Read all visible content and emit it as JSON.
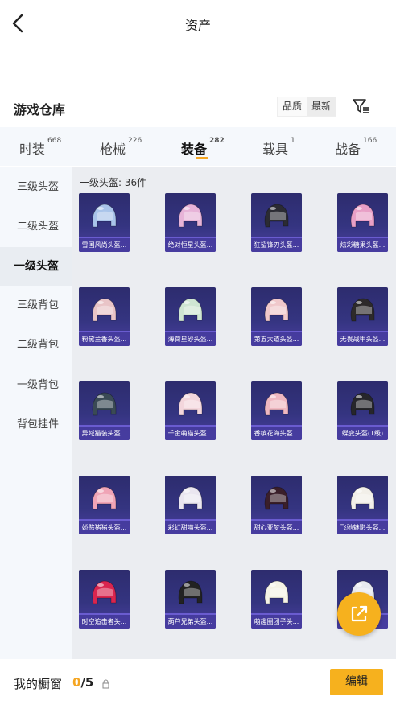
{
  "header": {
    "title": "资产"
  },
  "warehouse": {
    "title": "游戏仓库",
    "sort_options": [
      "品质",
      "最新"
    ],
    "sort_active": "最新"
  },
  "tabs": [
    {
      "label": "时装",
      "count": "668"
    },
    {
      "label": "枪械",
      "count": "226"
    },
    {
      "label": "装备",
      "count": "282"
    },
    {
      "label": "载具",
      "count": "1"
    },
    {
      "label": "战备",
      "count": "166"
    }
  ],
  "sidebar": [
    {
      "label": "三级头盔"
    },
    {
      "label": "二级头盔"
    },
    {
      "label": "一级头盔"
    },
    {
      "label": "三级背包"
    },
    {
      "label": "二级背包"
    },
    {
      "label": "一级背包"
    },
    {
      "label": "背包挂件"
    }
  ],
  "section": {
    "label": "一级头盔: 36件"
  },
  "items": [
    {
      "name": "雪国风尚头盔...",
      "color": "#a9c4ea"
    },
    {
      "name": "绝对恒星头盔...",
      "color": "#e7b3d8"
    },
    {
      "name": "狂鲨锋刃头盔...",
      "color": "#2b2b33"
    },
    {
      "name": "炫彩糖果头盔...",
      "color": "#e89fc6"
    },
    {
      "name": "粉黛兰香头盔...",
      "color": "#e9c4c7"
    },
    {
      "name": "薄荷星砂头盔...",
      "color": "#cfe6d2"
    },
    {
      "name": "第五大道头盔...",
      "color": "#f0c8cb"
    },
    {
      "name": "无畏战甲头盔...",
      "color": "#2d2a2a"
    },
    {
      "name": "异域猎装头盔...",
      "color": "#3a4a55"
    },
    {
      "name": "千金萌猫头盔...",
      "color": "#f3d6dc"
    },
    {
      "name": "香槟花海头盔...",
      "color": "#efb8c1"
    },
    {
      "name": "蝶变头盔(1级)",
      "color": "#26262b"
    },
    {
      "name": "娇憨猪猪头盔...",
      "color": "#f0a4b6"
    },
    {
      "name": "彩虹甜喵头盔...",
      "color": "#eae6f0"
    },
    {
      "name": "甜心亚梦头盔...",
      "color": "#3a1f2a"
    },
    {
      "name": "飞驰魅影头盔...",
      "color": "#f2efe9"
    },
    {
      "name": "时空追击者头...",
      "color": "#d9254f"
    },
    {
      "name": "葫芦兄弟头盔...",
      "color": "#222222"
    },
    {
      "name": "萌趣圈团子头...",
      "color": "#f5f3e6"
    },
    {
      "name": "",
      "color": "#e8eaf0"
    }
  ],
  "bottom": {
    "label": "我的橱窗",
    "count_current": "0",
    "count_total": "/5",
    "edit_label": "编辑"
  },
  "colors": {
    "accent": "#f6b11e",
    "card_bg": "#343480"
  }
}
